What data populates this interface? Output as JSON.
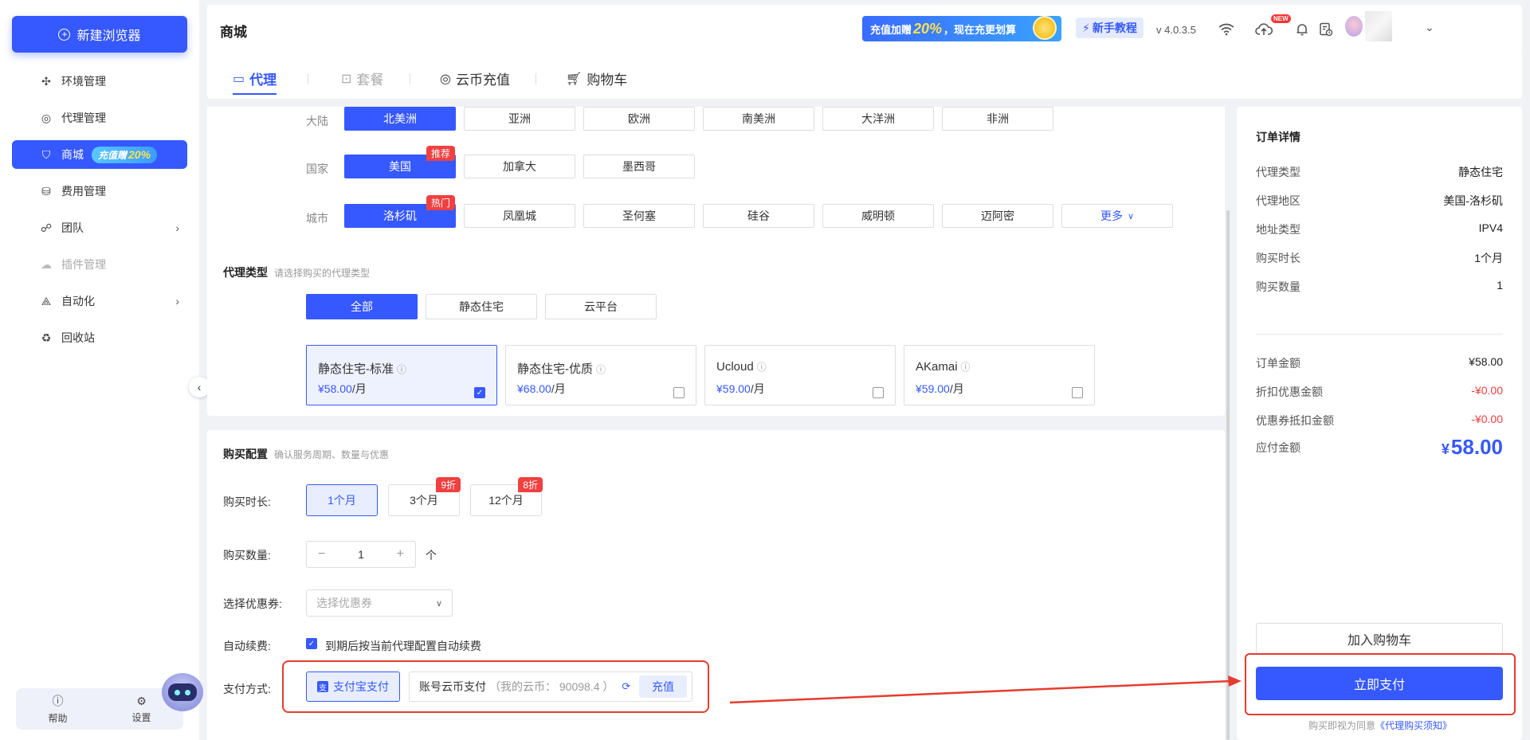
{
  "sidebar": {
    "new_browser": "新建浏览器",
    "items": [
      {
        "label": "环境管理",
        "icon": "environment-icon"
      },
      {
        "label": "代理管理",
        "icon": "globe-icon"
      },
      {
        "label": "商城",
        "icon": "shop-icon",
        "badge_text": "充值赠",
        "badge_pct": "20%"
      },
      {
        "label": "费用管理",
        "icon": "coins-icon"
      },
      {
        "label": "团队",
        "icon": "team-icon"
      },
      {
        "label": "插件管理",
        "icon": "plugin-icon"
      },
      {
        "label": "自动化",
        "icon": "automation-icon"
      },
      {
        "label": "回收站",
        "icon": "recycle-icon"
      }
    ],
    "help": "帮助",
    "settings": "设置"
  },
  "header": {
    "title": "商城",
    "promo_prefix": "充值加赠",
    "promo_pct": "20%",
    "promo_suffix": "，现在充更划算",
    "tutorial": "新手教程",
    "version": "v 4.0.3.5",
    "new_tag": "NEW"
  },
  "tabs": [
    {
      "label": "代理"
    },
    {
      "label": "套餐"
    },
    {
      "label": "云币充值"
    },
    {
      "label": "购物车"
    }
  ],
  "region": {
    "continent_label": "大陆",
    "continents": [
      "北美洲",
      "亚洲",
      "欧洲",
      "南美洲",
      "大洋洲",
      "非洲"
    ],
    "country_label": "国家",
    "countries": [
      "美国",
      "加拿大",
      "墨西哥"
    ],
    "country_tag": "推荐",
    "city_label": "城市",
    "cities": [
      "洛杉矶",
      "凤凰城",
      "圣何塞",
      "硅谷",
      "威明顿",
      "迈阿密"
    ],
    "city_tag": "热门",
    "more": "更多"
  },
  "proxy_type": {
    "title": "代理类型",
    "subtitle": "请选择购买的代理类型",
    "filters": [
      "全部",
      "静态住宅",
      "云平台"
    ],
    "cards": [
      {
        "name": "静态住宅-标准",
        "price": "¥58.00",
        "unit": "/月",
        "checked": true
      },
      {
        "name": "静态住宅-优质",
        "price": "¥68.00",
        "unit": "/月",
        "checked": false
      },
      {
        "name": "Ucloud",
        "price": "¥59.00",
        "unit": "/月",
        "checked": false
      },
      {
        "name": "AKamai",
        "price": "¥59.00",
        "unit": "/月",
        "checked": false
      }
    ]
  },
  "purchase": {
    "title": "购买配置",
    "subtitle": "确认服务周期、数量与优惠",
    "duration_label": "购买时长:",
    "durations": [
      {
        "label": "1个月",
        "tag": ""
      },
      {
        "label": "3个月",
        "tag": "9折"
      },
      {
        "label": "12个月",
        "tag": "8折"
      }
    ],
    "quantity_label": "购买数量:",
    "quantity": "1",
    "quantity_unit": "个",
    "coupon_label": "选择优惠券:",
    "coupon_placeholder": "选择优惠券",
    "renew_label": "自动续费:",
    "renew_text": "到期后按当前代理配置自动续费",
    "payment_label": "支付方式:",
    "alipay": "支付宝支付",
    "cloud_pay": "账号云币支付",
    "cloud_balance": "（我的云币： 90098.4 ）",
    "recharge": "充值"
  },
  "order": {
    "title": "订单详情",
    "rows": [
      {
        "k": "代理类型",
        "v": "静态住宅"
      },
      {
        "k": "代理地区",
        "v": "美国-洛杉矶"
      },
      {
        "k": "地址类型",
        "v": "IPV4"
      },
      {
        "k": "购买时长",
        "v": "1个月"
      },
      {
        "k": "购买数量",
        "v": "1"
      }
    ],
    "amount_label": "订单金额",
    "amount": "¥58.00",
    "discount_label": "折扣优惠金额",
    "discount": "-¥0.00",
    "coupon_label": "优惠券抵扣金额",
    "coupon": "-¥0.00",
    "payable_label": "应付金额",
    "payable_yen": "¥",
    "payable": "58.00",
    "cart_btn": "加入购物车",
    "pay_btn": "立即支付",
    "agree_prefix": "购买即视为同意",
    "agree_link": "《代理购买须知》"
  },
  "colors": {
    "accent": "#3658ff",
    "annotation": "#e63c2e",
    "danger": "#f04040"
  }
}
